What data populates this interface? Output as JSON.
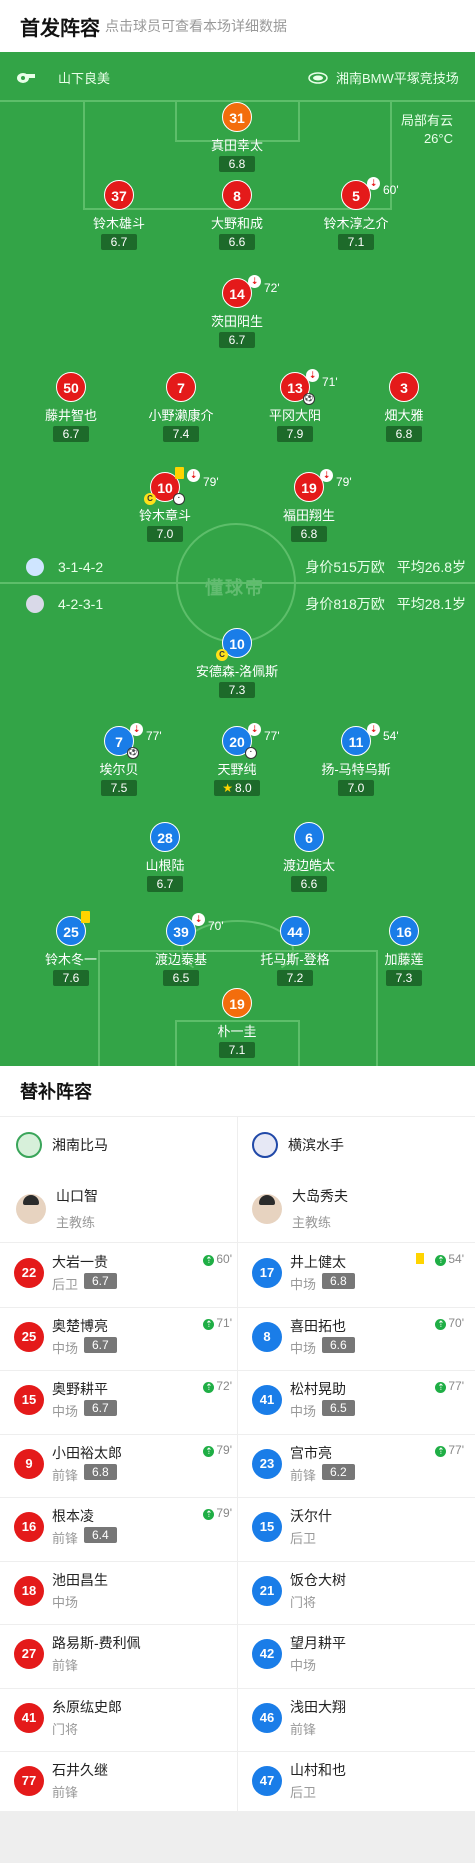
{
  "header": {
    "title": "首发阵容",
    "hint": "点击球员可查看本场详细数据"
  },
  "match": {
    "referee": "山下良美",
    "venue": "湘南BMW平塚竞技场",
    "weather": "局部有云",
    "temperature": "26°C"
  },
  "home": {
    "formation": "3-1-4-2",
    "value": "身价515万欧",
    "avg_age": "平均26.8岁",
    "color": "#e41a1a",
    "players": [
      {
        "num": "31",
        "name": "真田幸太",
        "rating": "6.8"
      },
      {
        "num": "37",
        "name": "铃木雄斗",
        "rating": "6.7"
      },
      {
        "num": "8",
        "name": "大野和成",
        "rating": "6.6"
      },
      {
        "num": "5",
        "name": "铃木淳之介",
        "rating": "7.1",
        "sub": "60'"
      },
      {
        "num": "14",
        "name": "茨田阳生",
        "rating": "6.7",
        "sub": "72'"
      },
      {
        "num": "50",
        "name": "藤井智也",
        "rating": "6.7"
      },
      {
        "num": "7",
        "name": "小野濑康介",
        "rating": "7.4"
      },
      {
        "num": "13",
        "name": "平冈大阳",
        "rating": "7.9",
        "sub": "71'"
      },
      {
        "num": "3",
        "name": "畑大雅",
        "rating": "6.8"
      },
      {
        "num": "10",
        "name": "铃木章斗",
        "rating": "7.0",
        "sub": "79'"
      },
      {
        "num": "19",
        "name": "福田翔生",
        "rating": "6.8",
        "sub": "79'"
      }
    ]
  },
  "away": {
    "formation": "4-2-3-1",
    "value": "身价818万欧",
    "avg_age": "平均28.1岁",
    "color": "#1a7de8",
    "players": [
      {
        "num": "10",
        "name": "安德森-洛佩斯",
        "rating": "7.3"
      },
      {
        "num": "7",
        "name": "埃尔贝",
        "rating": "7.5",
        "sub": "77'"
      },
      {
        "num": "20",
        "name": "天野纯",
        "rating": "8.0",
        "sub": "77'"
      },
      {
        "num": "11",
        "name": "扬-马特乌斯",
        "rating": "7.0",
        "sub": "54'"
      },
      {
        "num": "28",
        "name": "山根陆",
        "rating": "6.7"
      },
      {
        "num": "6",
        "name": "渡边皓太",
        "rating": "6.6"
      },
      {
        "num": "25",
        "name": "铃木冬一",
        "rating": "7.6"
      },
      {
        "num": "39",
        "name": "渡边泰基",
        "rating": "6.5",
        "sub": "70'"
      },
      {
        "num": "44",
        "name": "托马斯-登格",
        "rating": "7.2"
      },
      {
        "num": "16",
        "name": "加藤莲",
        "rating": "7.3"
      },
      {
        "num": "19",
        "name": "朴一圭",
        "rating": "7.1"
      }
    ]
  },
  "watermark": "懂球帝",
  "bench": {
    "title": "替补阵容",
    "home_team": "湘南比马",
    "away_team": "横滨水手",
    "home_coach": {
      "name": "山口智",
      "role": "主教练"
    },
    "away_coach": {
      "name": "大岛秀夫",
      "role": "主教练"
    },
    "home": [
      {
        "num": "22",
        "name": "大岩一贵",
        "pos": "后卫",
        "rating": "6.7",
        "min": "60'"
      },
      {
        "num": "25",
        "name": "奥楚博亮",
        "pos": "中场",
        "rating": "6.7",
        "min": "71'"
      },
      {
        "num": "15",
        "name": "奥野耕平",
        "pos": "中场",
        "rating": "6.7",
        "min": "72'"
      },
      {
        "num": "9",
        "name": "小田裕太郎",
        "pos": "前锋",
        "rating": "6.8",
        "min": "79'"
      },
      {
        "num": "16",
        "name": "根本凌",
        "pos": "前锋",
        "rating": "6.4",
        "min": "79'"
      },
      {
        "num": "18",
        "name": "池田昌生",
        "pos": "中场"
      },
      {
        "num": "27",
        "name": "路易斯-费利佩",
        "pos": "前锋"
      },
      {
        "num": "41",
        "name": "糸原纮史郎",
        "pos": "门将"
      },
      {
        "num": "77",
        "name": "石井久继",
        "pos": "前锋"
      }
    ],
    "away": [
      {
        "num": "17",
        "name": "井上健太",
        "pos": "中场",
        "rating": "6.8",
        "min": "54'"
      },
      {
        "num": "8",
        "name": "喜田拓也",
        "pos": "中场",
        "rating": "6.6",
        "min": "70'"
      },
      {
        "num": "41",
        "name": "松村晃助",
        "pos": "中场",
        "rating": "6.5",
        "min": "77'"
      },
      {
        "num": "23",
        "name": "宫市亮",
        "pos": "前锋",
        "rating": "6.2",
        "min": "77'"
      },
      {
        "num": "15",
        "name": "沃尔什",
        "pos": "后卫"
      },
      {
        "num": "21",
        "name": "饭仓大树",
        "pos": "门将"
      },
      {
        "num": "42",
        "name": "望月耕平",
        "pos": "中场"
      },
      {
        "num": "46",
        "name": "浅田大翔",
        "pos": "前锋"
      },
      {
        "num": "47",
        "name": "山村和也",
        "pos": "后卫"
      }
    ]
  }
}
